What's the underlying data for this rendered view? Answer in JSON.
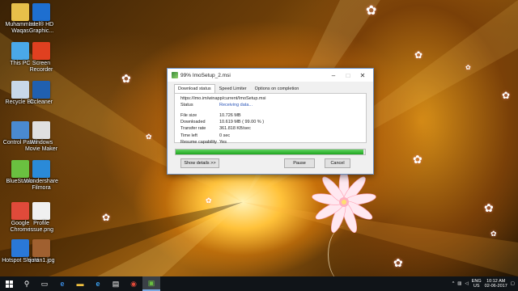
{
  "desktop_icons": [
    {
      "label": "Muhammad Waqas",
      "color": "#e8c04a"
    },
    {
      "label": "Intel® HD Graphic...",
      "color": "#1e6fd0"
    },
    {
      "label": "This PC",
      "color": "#4aa8e8"
    },
    {
      "label": "Screen Recorder",
      "color": "#e04020"
    },
    {
      "label": "Recycle Bin",
      "color": "#c8d8e8"
    },
    {
      "label": "Ccleaner",
      "color": "#2060b0"
    },
    {
      "label": "Control Panel",
      "color": "#4a8ad0"
    },
    {
      "label": "Windows Movie Maker",
      "color": "#e0e0e0"
    },
    {
      "label": "BlueStacks",
      "color": "#6ac040"
    },
    {
      "label": "Wondershare Filmora",
      "color": "#2a8ad8"
    },
    {
      "label": "Google Chrome",
      "color": "#e04a3a"
    },
    {
      "label": "Profile issue.png",
      "color": "#f0f0f0"
    },
    {
      "label": "Hotspot Shield",
      "color": "#2a78d8"
    },
    {
      "label": "quran1.jpg",
      "color": "#a06030"
    }
  ],
  "dialog": {
    "title": "99% ImoSetup_2.msi",
    "tabs": [
      "Download status",
      "Speed Limiter",
      "Options on completion"
    ],
    "url": "https://imo.im/winapp/current/ImoSetup.msi",
    "status_label": "Status",
    "status_value": "Receiving data...",
    "rows": [
      {
        "key": "File size",
        "value": "10.726  MB"
      },
      {
        "key": "Downloaded",
        "value": "10.619  MB  ( 99.00 % )"
      },
      {
        "key": "Transfer rate",
        "value": "361.818  KB/sec"
      },
      {
        "key": "Time left",
        "value": "0 sec"
      },
      {
        "key": "Resume capability",
        "value": "Yes"
      }
    ],
    "progress": 0.99,
    "show_details": "Show details >>",
    "pause": "Pause",
    "cancel": "Cancel"
  },
  "taskbar": {
    "lang": "ENG",
    "region": "US",
    "time": "10:12 AM",
    "date": "02-06-2017"
  },
  "colors": {
    "accent": "#2b55b8",
    "progress": "#1fa41f",
    "taskbar": "#101418"
  }
}
